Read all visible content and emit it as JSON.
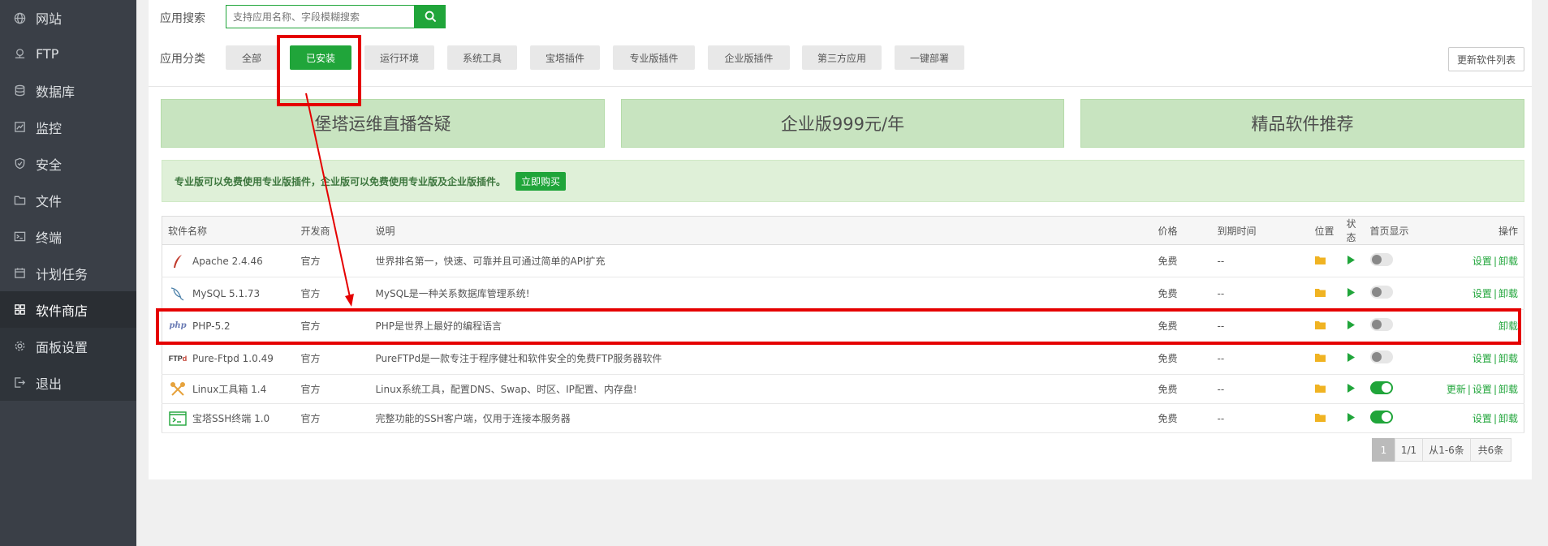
{
  "sidebar": {
    "items": [
      {
        "label": "网站",
        "icon": "globe-icon"
      },
      {
        "label": "FTP",
        "icon": "ftp-icon"
      },
      {
        "label": "数据库",
        "icon": "database-icon"
      },
      {
        "label": "监控",
        "icon": "monitor-icon"
      },
      {
        "label": "安全",
        "icon": "shield-icon"
      },
      {
        "label": "文件",
        "icon": "folder-icon"
      },
      {
        "label": "终端",
        "icon": "terminal-icon"
      },
      {
        "label": "计划任务",
        "icon": "calendar-icon"
      },
      {
        "label": "软件商店",
        "icon": "grid-icon"
      },
      {
        "label": "面板设置",
        "icon": "gear-icon"
      },
      {
        "label": "退出",
        "icon": "logout-icon"
      }
    ],
    "active_index": 8
  },
  "search": {
    "label": "应用搜索",
    "placeholder": "支持应用名称、字段模糊搜索"
  },
  "categories": {
    "label": "应用分类",
    "items": [
      "全部",
      "已安装",
      "运行环境",
      "系统工具",
      "宝塔插件",
      "专业版插件",
      "企业版插件",
      "第三方应用",
      "一键部署"
    ],
    "active": "已安装"
  },
  "refresh_label": "更新软件列表",
  "banners": [
    "堡塔运维直播答疑",
    "企业版999元/年",
    "精品软件推荐"
  ],
  "notice": {
    "text": "专业版可以免费使用专业版插件，企业版可以免费使用专业版及企业版插件。",
    "buy_label": "立即购买"
  },
  "table": {
    "headers": [
      "软件名称",
      "开发商",
      "说明",
      "价格",
      "到期时间",
      "位置",
      "状态",
      "首页显示",
      "操作"
    ],
    "rows": [
      {
        "name": "Apache 2.4.46",
        "icon": "apache-feather-icon",
        "vendor": "官方",
        "desc": "世界排名第一，快速、可靠并且可通过简单的API扩充",
        "price": "免费",
        "expire": "--",
        "home_on": false,
        "ops": [
          "设置",
          "卸载"
        ]
      },
      {
        "name": "MySQL 5.1.73",
        "icon": "mysql-dolphin-icon",
        "vendor": "官方",
        "desc": "MySQL是一种关系数据库管理系统!",
        "price": "免费",
        "expire": "--",
        "home_on": false,
        "ops": [
          "设置",
          "卸载"
        ]
      },
      {
        "name": "PHP-5.2",
        "icon": "php-icon",
        "vendor": "官方",
        "desc": "PHP是世界上最好的编程语言",
        "price": "免费",
        "expire": "--",
        "home_on": false,
        "ops": [
          "卸载"
        ]
      },
      {
        "name": "Pure-Ftpd 1.0.49",
        "icon": "ftpd-icon",
        "vendor": "官方",
        "desc": "PureFTPd是一款专注于程序健壮和软件安全的免费FTP服务器软件",
        "price": "免费",
        "expire": "--",
        "home_on": false,
        "ops": [
          "设置",
          "卸载"
        ]
      },
      {
        "name": "Linux工具箱 1.4",
        "icon": "tools-icon",
        "vendor": "官方",
        "desc": "Linux系统工具，配置DNS、Swap、时区、IP配置、内存盘!",
        "price": "免费",
        "expire": "--",
        "home_on": true,
        "ops": [
          "更新",
          "设置",
          "卸载"
        ]
      },
      {
        "name": "宝塔SSH终端 1.0",
        "icon": "ssh-terminal-icon",
        "vendor": "官方",
        "desc": "完整功能的SSH客户端，仅用于连接本服务器",
        "price": "免费",
        "expire": "--",
        "home_on": true,
        "ops": [
          "设置",
          "卸载"
        ]
      }
    ]
  },
  "pagination": {
    "current": "1",
    "pages": "1/1",
    "range": "从1-6条",
    "total": "共6条"
  },
  "colors": {
    "accent": "#20a53a",
    "sidebar_bg": "#3a3f47",
    "annotation": "#e50000"
  }
}
